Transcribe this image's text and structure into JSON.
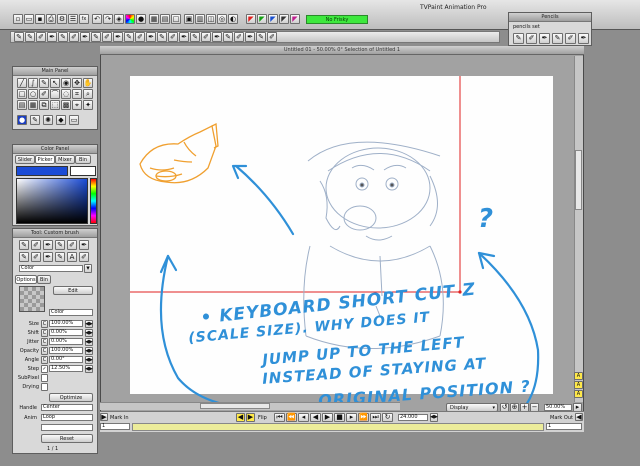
{
  "app": {
    "title": "TVPaint Animation Pro"
  },
  "toolbar": {
    "frisky_label": "No Frisky"
  },
  "pencils_panel": {
    "title": "Pencils",
    "set_label": "pencils set"
  },
  "main_panel": {
    "title": "Main Panel"
  },
  "color_panel": {
    "title": "Color Panel",
    "tabs": [
      "Slider",
      "Picker",
      "Mixer",
      "Bin"
    ]
  },
  "tool_panel": {
    "title": "Tool: Custom brush",
    "tabs": [
      "Options",
      "Bin"
    ],
    "preset": "Color",
    "edit_label": "Edit",
    "mode": "Color",
    "params": [
      {
        "label": "Size",
        "value": "100.00%"
      },
      {
        "label": "Shift",
        "value": "0.00%"
      },
      {
        "label": "Jitter",
        "value": "0.00%"
      },
      {
        "label": "Opacity",
        "value": "100.00%"
      },
      {
        "label": "Angle",
        "value": "0.00°"
      },
      {
        "label": "Step",
        "value": "12.50%"
      }
    ],
    "subpixel_label": "SubPixel",
    "drying_label": "Drying",
    "optimize_label": "Optimize",
    "handle_label": "Handle",
    "handle_value": "Center",
    "anim_label": "Anim",
    "anim_value": "Loop",
    "reset_label": "Reset",
    "page_indicator": "1 / 1"
  },
  "canvas": {
    "title": "Untitled 01 - 50.00%    0°  Selection of Untitled 1"
  },
  "bottom": {
    "display_label": "Display",
    "zoom_value": "50.00%",
    "mark_in_label": "Mark In",
    "mark_out_label": "Mark Out",
    "flip_label": "Flip",
    "fps_value": "24.000",
    "frame_start": "1",
    "frame_end": "1"
  },
  "annotation": {
    "line1": "• KEYBOARD SHORT CUT Z",
    "line2": "(SCALE SIZE). WHY DOES IT",
    "line3": "JUMP UP TO THE LEFT",
    "line4": "INSTEAD OF STAYING AT",
    "line5": "ORIGINAL POSITION ?",
    "question": "?"
  },
  "colors": {
    "annotation_blue": "#2f90d8",
    "sketch_orange": "#f0a030",
    "selection_red": "#e02020",
    "frisky_green": "#3ee83e"
  }
}
